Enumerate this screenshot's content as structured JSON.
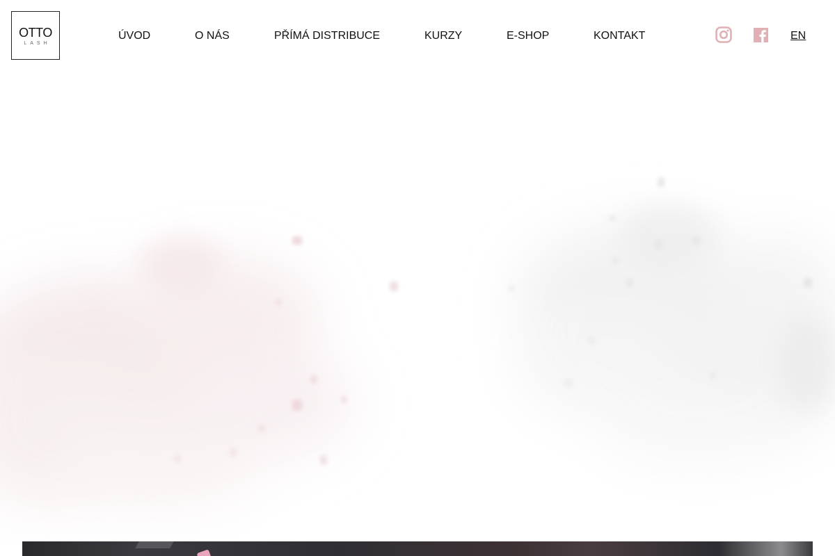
{
  "logo": {
    "title": "OTTO",
    "subtitle": "LASH"
  },
  "nav": {
    "items": [
      {
        "label": "ÚVOD"
      },
      {
        "label": "O NÁS"
      },
      {
        "label": "PŘÍMÁ DISTRIBUCE"
      },
      {
        "label": "KURZY"
      },
      {
        "label": "E-SHOP"
      },
      {
        "label": "KONTAKT"
      }
    ]
  },
  "social": {
    "instagram_icon": "instagram-icon",
    "facebook_icon": "facebook-icon",
    "accent_color": "#e0b0b4"
  },
  "language": {
    "label": "EN"
  },
  "hero": {
    "texture": "pink-powder-smoke"
  }
}
